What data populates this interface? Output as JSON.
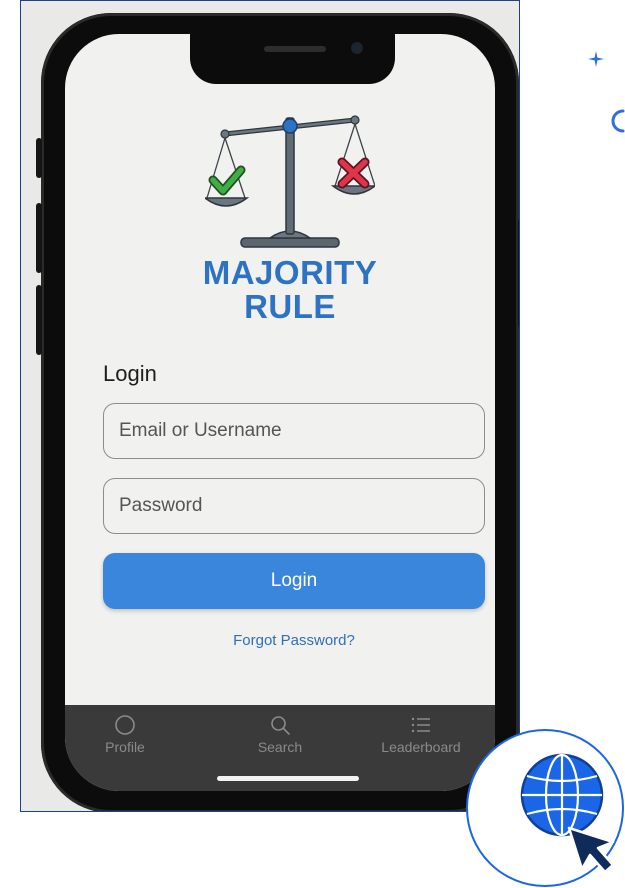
{
  "app": {
    "name_line1": "MAJORITY",
    "name_line2": "RULE"
  },
  "login": {
    "heading": "Login",
    "email_placeholder": "Email or Username",
    "password_placeholder": "Password",
    "submit_label": "Login",
    "forgot_label": "Forgot Password?"
  },
  "nav": {
    "items": [
      {
        "label": "Profile",
        "icon": "profile-circle-icon"
      },
      {
        "label": "Search",
        "icon": "search-icon"
      },
      {
        "label": "Leaderboard",
        "icon": "list-icon"
      }
    ]
  },
  "colors": {
    "brand": "#2e72c4",
    "button": "#3a86dc",
    "link": "#2f6fb8",
    "navbar": "#3a3a3a",
    "check": "#3fae45",
    "cross": "#e0344a",
    "badge": "#1a66e6"
  }
}
